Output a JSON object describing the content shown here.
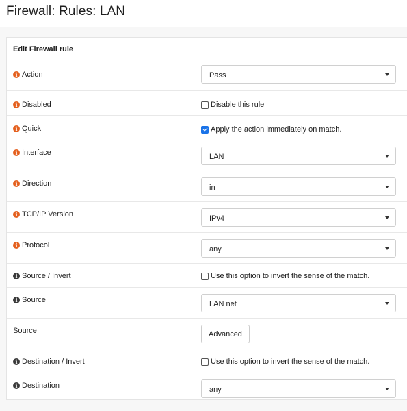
{
  "page": {
    "title": "Firewall: Rules: LAN"
  },
  "panel": {
    "heading": "Edit Firewall rule"
  },
  "rows": {
    "action": {
      "label": "Action",
      "value": "Pass"
    },
    "disabled": {
      "label": "Disabled",
      "checkbox_label": "Disable this rule",
      "checked": false
    },
    "quick": {
      "label": "Quick",
      "checkbox_label": "Apply the action immediately on match.",
      "checked": true
    },
    "interface": {
      "label": "Interface",
      "value": "LAN"
    },
    "direction": {
      "label": "Direction",
      "value": "in"
    },
    "tcpip": {
      "label": "TCP/IP Version",
      "value": "IPv4"
    },
    "protocol": {
      "label": "Protocol",
      "value": "any"
    },
    "source_invert": {
      "label": "Source / Invert",
      "checkbox_label": "Use this option to invert the sense of the match.",
      "checked": false
    },
    "source": {
      "label": "Source",
      "value": "LAN net"
    },
    "source_adv": {
      "label": "Source",
      "button_label": "Advanced"
    },
    "dest_invert": {
      "label": "Destination / Invert",
      "checkbox_label": "Use this option to invert the sense of the match.",
      "checked": false
    },
    "destination": {
      "label": "Destination",
      "value": "any"
    }
  },
  "icons": {
    "info": "info-icon",
    "caret": "chevron-down-icon"
  },
  "colors": {
    "info_required": "#e4601e",
    "info_optional": "#3a3a3a",
    "checkbox_checked": "#1a73e8"
  }
}
